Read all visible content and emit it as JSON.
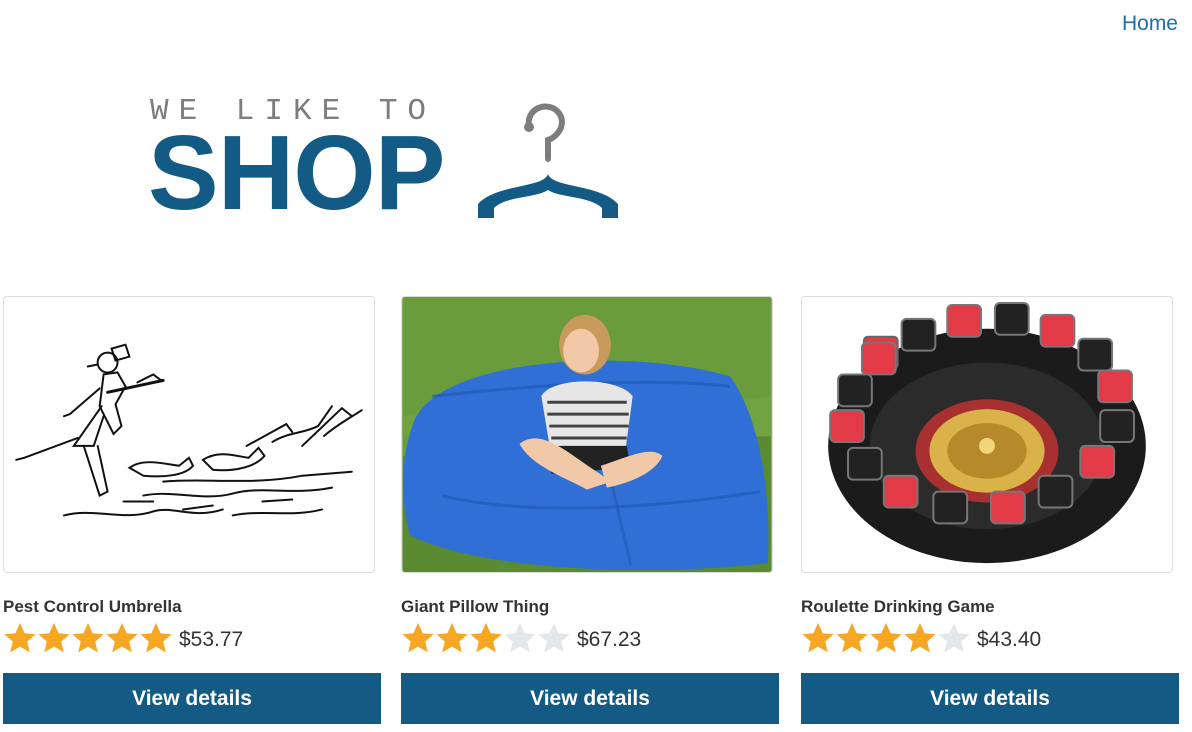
{
  "nav": {
    "home_label": "Home"
  },
  "logo": {
    "top_text": "WE LIKE TO",
    "main_text": "SHOP",
    "icon": "hanger-icon"
  },
  "colors": {
    "brand": "#135b84",
    "link": "#1a6fa8",
    "star_filled": "#f5a623",
    "star_empty": "#e4e7ea"
  },
  "products": [
    {
      "title": "Pest Control Umbrella",
      "rating": 5,
      "max_rating": 5,
      "price": "$53.77",
      "button_label": "View details",
      "image": "umbrella-cats-drawing"
    },
    {
      "title": "Giant Pillow Thing",
      "rating": 3,
      "max_rating": 5,
      "price": "$67.23",
      "button_label": "View details",
      "image": "girl-on-blue-pillow"
    },
    {
      "title": "Roulette Drinking Game",
      "rating": 4,
      "max_rating": 5,
      "price": "$43.40",
      "button_label": "View details",
      "image": "roulette-shot-glasses"
    }
  ]
}
